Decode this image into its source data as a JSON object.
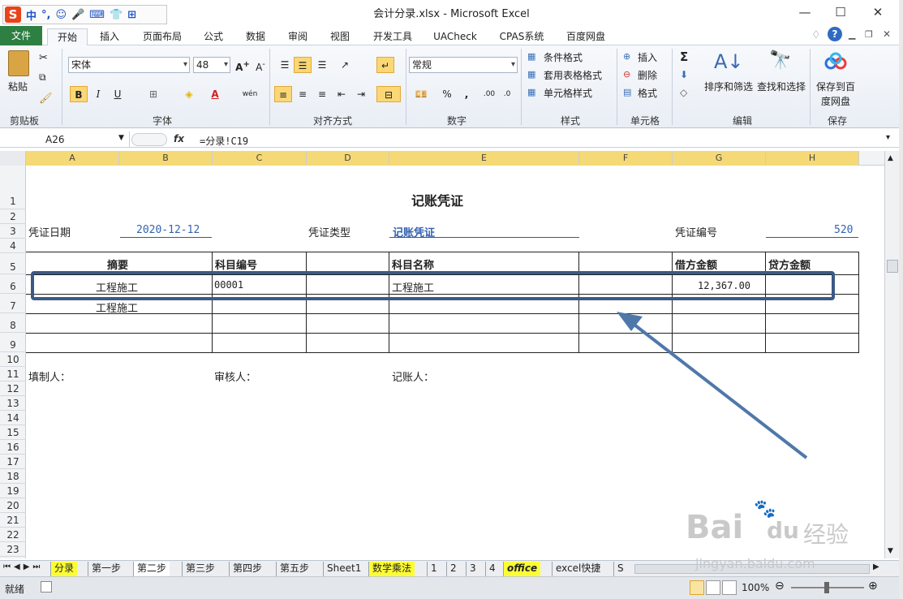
{
  "window": {
    "title": "会计分录.xlsx - Microsoft Excel",
    "minimize": "—",
    "maximize": "☐",
    "close": "✕"
  },
  "ime": {
    "logo": "S",
    "items": [
      "中",
      "°,",
      "☺",
      "🎤",
      "⌨",
      "👕",
      "⊞"
    ]
  },
  "ribbon_tabs": [
    "文件",
    "开始",
    "插入",
    "页面布局",
    "公式",
    "数据",
    "审阅",
    "视图",
    "开发工具",
    "UACheck",
    "CPAS系统",
    "百度网盘"
  ],
  "ribbon": {
    "clipboard": {
      "label": "剪贴板",
      "paste": "粘贴"
    },
    "font": {
      "label": "字体",
      "name": "宋体",
      "size": "48",
      "bold": "B",
      "italic": "I",
      "underline": "U",
      "wen": "wén"
    },
    "align": {
      "label": "对齐方式"
    },
    "number": {
      "label": "数字",
      "format": "常规",
      "percent": "%",
      "comma": ","
    },
    "styles": {
      "label": "样式",
      "cond": "条件格式",
      "table": "套用表格格式",
      "cell": "单元格样式"
    },
    "cells": {
      "label": "单元格",
      "insert": "插入",
      "delete": "删除",
      "format": "格式"
    },
    "editing": {
      "label": "编辑",
      "sum": "Σ",
      "sort": "排序和筛选",
      "find": "查找和选择"
    },
    "save": {
      "label": "保存",
      "btn1": "保存到百",
      "btn2": "度网盘"
    }
  },
  "formula_bar": {
    "name_box": "A26",
    "fx": "fx",
    "formula": "=分录!C19"
  },
  "columns": [
    "A",
    "B",
    "C",
    "D",
    "E",
    "F",
    "G",
    "H"
  ],
  "rows": [
    "1",
    "2",
    "3",
    "4",
    "5",
    "6",
    "7",
    "8",
    "9",
    "10",
    "11",
    "12",
    "13",
    "14",
    "15",
    "16",
    "17",
    "18",
    "19",
    "20",
    "21",
    "22",
    "23"
  ],
  "voucher": {
    "title": "记账凭证",
    "date_label": "凭证日期",
    "date": "2020-12-12",
    "type_label": "凭证类型",
    "type": "记账凭证",
    "no_label": "凭证编号",
    "no": "520",
    "headers": {
      "summary": "摘要",
      "code": "科目编号",
      "name": "科目名称",
      "debit": "借方金额",
      "credit": "贷方金额"
    },
    "row6": {
      "summary": "工程施工",
      "code": "00001",
      "name": "工程施工",
      "debit": "12,367.00"
    },
    "row7": {
      "summary": "工程施工"
    },
    "maker": "填制人：",
    "checker": "审核人：",
    "bookkeeper": "记账人："
  },
  "sheet_tabs": [
    "分录",
    "第一步",
    "第二步",
    "第三步",
    "第四步",
    "第五步",
    "Sheet1",
    "数学乘法",
    "1",
    "2",
    "3",
    "4",
    "office",
    "excel快捷",
    "S"
  ],
  "status": {
    "ready": "就绪",
    "zoom": "100%"
  },
  "watermark": {
    "brand": "Bai",
    "paw": "du",
    "cn": "经验",
    "url": "jingyan.baidu.com"
  },
  "colors": {
    "accent_file": "#2d7f42",
    "highlight_box": "#3a5a86",
    "arrow": "#4f78aa",
    "link_blue": "#3362b1",
    "tab_yellow": "#fdfd35"
  }
}
